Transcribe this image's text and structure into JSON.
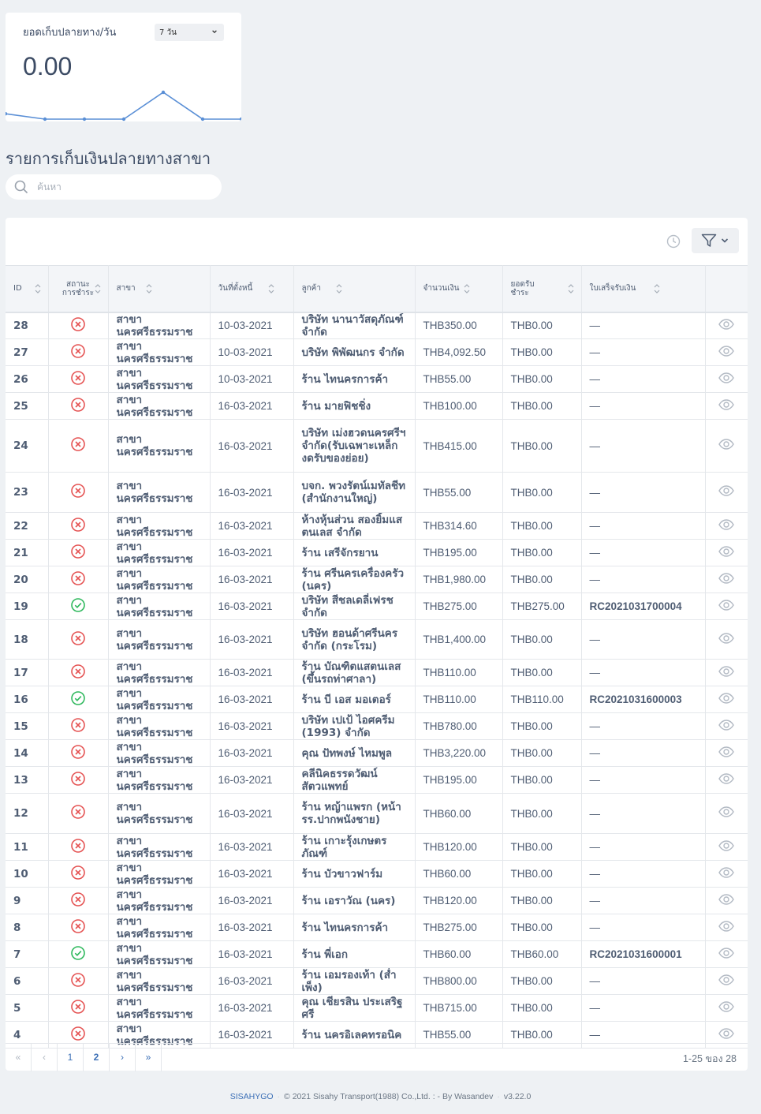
{
  "stat": {
    "title": "ยอดเก็บปลายทาง/วัน",
    "period": "7 วัน",
    "value": "0.00",
    "series": [
      0.2,
      0,
      0,
      0,
      1,
      0,
      0
    ]
  },
  "section_title": "รายการเก็บเงินปลายทางสาขา",
  "search": {
    "placeholder": "ค้นหา",
    "value": ""
  },
  "table": {
    "headers": {
      "id": "ID",
      "status": "สถานะการชำระ",
      "branch": "สาขา",
      "date": "วันที่ตั้งหนี้",
      "customer": "ลูกค้า",
      "amount": "จำนวนเงิน",
      "paid": "ยอดรับชำระ",
      "receipt": "ใบเสร็จรับเงิน"
    },
    "rows": [
      {
        "id": "28",
        "status": "unpaid",
        "branch": "สาขา นครศรีธรรมราช",
        "date": "10-03-2021",
        "customer": "บริษัท นานาวัสดุภัณฑ์ จำกัด",
        "amount": "THB350.00",
        "paid": "THB0.00",
        "receipt": "—"
      },
      {
        "id": "27",
        "status": "unpaid",
        "branch": "สาขา นครศรีธรรมราช",
        "date": "10-03-2021",
        "customer": "บริษัท พิพัฒนกร จำกัด",
        "amount": "THB4,092.50",
        "paid": "THB0.00",
        "receipt": "—"
      },
      {
        "id": "26",
        "status": "unpaid",
        "branch": "สาขา นครศรีธรรมราช",
        "date": "10-03-2021",
        "customer": "ร้าน ไทนครการค้า",
        "amount": "THB55.00",
        "paid": "THB0.00",
        "receipt": "—"
      },
      {
        "id": "25",
        "status": "unpaid",
        "branch": "สาขา นครศรีธรรมราช",
        "date": "16-03-2021",
        "customer": "ร้าน มายฟิชชิ่ง",
        "amount": "THB100.00",
        "paid": "THB0.00",
        "receipt": "—"
      },
      {
        "id": "24",
        "status": "unpaid",
        "branch": "สาขา นครศรีธรรมราช",
        "date": "16-03-2021",
        "customer": "บริษัท เม่งฮวดนครศรีฯจำกัด(รับเฉพาะเหล็ก งดรับของย่อย)",
        "amount": "THB415.00",
        "paid": "THB0.00",
        "receipt": "—"
      },
      {
        "id": "23",
        "status": "unpaid",
        "branch": "สาขา นครศรีธรรมราช",
        "date": "16-03-2021",
        "customer": "บจก. พวงรัตน์เมทัลชีท (สำนักงานใหญ่)",
        "amount": "THB55.00",
        "paid": "THB0.00",
        "receipt": "—"
      },
      {
        "id": "22",
        "status": "unpaid",
        "branch": "สาขา นครศรีธรรมราช",
        "date": "16-03-2021",
        "customer": "ห้างหุ้นส่วน สองยิ้มแสตนเลส จำกัด",
        "amount": "THB314.60",
        "paid": "THB0.00",
        "receipt": "—"
      },
      {
        "id": "21",
        "status": "unpaid",
        "branch": "สาขา นครศรีธรรมราช",
        "date": "16-03-2021",
        "customer": "ร้าน เสรีจักรยาน",
        "amount": "THB195.00",
        "paid": "THB0.00",
        "receipt": "—"
      },
      {
        "id": "20",
        "status": "unpaid",
        "branch": "สาขา นครศรีธรรมราช",
        "date": "16-03-2021",
        "customer": "ร้าน ศรีนครเครื่องครัว (นคร)",
        "amount": "THB1,980.00",
        "paid": "THB0.00",
        "receipt": "—"
      },
      {
        "id": "19",
        "status": "paid",
        "branch": "สาขา นครศรีธรรมราช",
        "date": "16-03-2021",
        "customer": "บริษัท สีชลเดลี่เฟรช จำกัด",
        "amount": "THB275.00",
        "paid": "THB275.00",
        "receipt": "RC2021031700004"
      },
      {
        "id": "18",
        "status": "unpaid",
        "branch": "สาขา นครศรีธรรมราช",
        "date": "16-03-2021",
        "customer": "บริษัท ฮอนด้าศรีนคร จำกัด (กระโรม)",
        "amount": "THB1,400.00",
        "paid": "THB0.00",
        "receipt": "—"
      },
      {
        "id": "17",
        "status": "unpaid",
        "branch": "สาขา นครศรีธรรมราช",
        "date": "16-03-2021",
        "customer": "ร้าน บัณฑิตแสตนเลส (ขึ้นรถท่าศาลา)",
        "amount": "THB110.00",
        "paid": "THB0.00",
        "receipt": "—"
      },
      {
        "id": "16",
        "status": "paid",
        "branch": "สาขา นครศรีธรรมราช",
        "date": "16-03-2021",
        "customer": "ร้าน บี เอส มอเตอร์",
        "amount": "THB110.00",
        "paid": "THB110.00",
        "receipt": "RC2021031600003"
      },
      {
        "id": "15",
        "status": "unpaid",
        "branch": "สาขา นครศรีธรรมราช",
        "date": "16-03-2021",
        "customer": "บริษัท เปเป้ ไอศครีม (1993) จำกัด",
        "amount": "THB780.00",
        "paid": "THB0.00",
        "receipt": "—"
      },
      {
        "id": "14",
        "status": "unpaid",
        "branch": "สาขา นครศรีธรรมราช",
        "date": "16-03-2021",
        "customer": "คุณ ปัทพงษ์ ไหมพูล",
        "amount": "THB3,220.00",
        "paid": "THB0.00",
        "receipt": "—"
      },
      {
        "id": "13",
        "status": "unpaid",
        "branch": "สาขา นครศรีธรรมราช",
        "date": "16-03-2021",
        "customer": "คลีนิคธรรดวัฒน์สัตวแพทย์",
        "amount": "THB195.00",
        "paid": "THB0.00",
        "receipt": "—"
      },
      {
        "id": "12",
        "status": "unpaid",
        "branch": "สาขา นครศรีธรรมราช",
        "date": "16-03-2021",
        "customer": "ร้าน หญ้าแพรก (หน้า รร.ปากพนังชาย)",
        "amount": "THB60.00",
        "paid": "THB0.00",
        "receipt": "—"
      },
      {
        "id": "11",
        "status": "unpaid",
        "branch": "สาขา นครศรีธรรมราช",
        "date": "16-03-2021",
        "customer": "ร้าน เกาะรุ้งเกษตรภัณฑ์",
        "amount": "THB120.00",
        "paid": "THB0.00",
        "receipt": "—"
      },
      {
        "id": "10",
        "status": "unpaid",
        "branch": "สาขา นครศรีธรรมราช",
        "date": "16-03-2021",
        "customer": "ร้าน บัวขาวฟาร์ม",
        "amount": "THB60.00",
        "paid": "THB0.00",
        "receipt": "—"
      },
      {
        "id": "9",
        "status": "unpaid",
        "branch": "สาขา นครศรีธรรมราช",
        "date": "16-03-2021",
        "customer": "ร้าน เอราวัณ (นคร)",
        "amount": "THB120.00",
        "paid": "THB0.00",
        "receipt": "—"
      },
      {
        "id": "8",
        "status": "unpaid",
        "branch": "สาขา นครศรีธรรมราช",
        "date": "16-03-2021",
        "customer": "ร้าน ไทนครการค้า",
        "amount": "THB275.00",
        "paid": "THB0.00",
        "receipt": "—"
      },
      {
        "id": "7",
        "status": "paid",
        "branch": "สาขา นครศรีธรรมราช",
        "date": "16-03-2021",
        "customer": "ร้าน พี่เอก",
        "amount": "THB60.00",
        "paid": "THB60.00",
        "receipt": "RC2021031600001"
      },
      {
        "id": "6",
        "status": "unpaid",
        "branch": "สาขา นครศรีธรรมราช",
        "date": "16-03-2021",
        "customer": "ร้าน เอมรองเท้า (ส่ำเพ็ง)",
        "amount": "THB800.00",
        "paid": "THB0.00",
        "receipt": "—"
      },
      {
        "id": "5",
        "status": "unpaid",
        "branch": "สาขา นครศรีธรรมราช",
        "date": "16-03-2021",
        "customer": "คุณ เชียรสิน ประเสริฐศรี",
        "amount": "THB715.00",
        "paid": "THB0.00",
        "receipt": "—"
      },
      {
        "id": "4",
        "status": "unpaid",
        "branch": "สาขา นครศรีธรรมราช",
        "date": "16-03-2021",
        "customer": "ร้าน นครอิเลคทรอนิค",
        "amount": "THB55.00",
        "paid": "THB0.00",
        "receipt": "—"
      }
    ]
  },
  "pagination": {
    "first": "«",
    "prev": "‹",
    "pages": [
      "1",
      "2"
    ],
    "active_page": "2",
    "next": "›",
    "last": "»",
    "range": "1-25 ของ 28"
  },
  "footer": {
    "brand": "SISAHYGO",
    "copyright": "© 2021 Sisahy Transport(1988) Co.,Ltd. : - By Wasandev",
    "version": "v3.22.0"
  },
  "colors": {
    "link": "#3b6fb6",
    "danger": "#e55353",
    "success": "#2eb85c"
  }
}
